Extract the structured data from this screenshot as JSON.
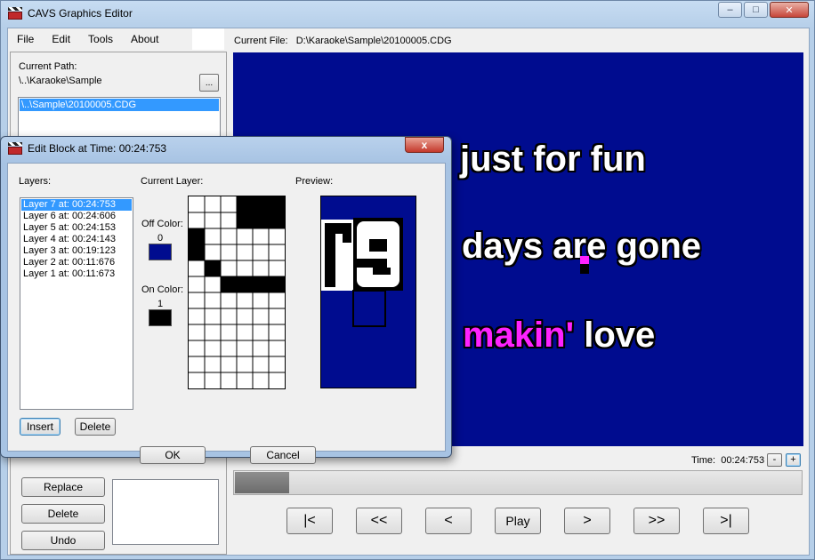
{
  "app": {
    "title": "CAVS Graphics Editor",
    "window_buttons": [
      "–",
      "□",
      "✕"
    ]
  },
  "menu": {
    "items": [
      "File",
      "Edit",
      "Tools",
      "About"
    ]
  },
  "left_panel": {
    "current_path_label": "Current Path:",
    "current_path_value": "\\..\\Karaoke\\Sample",
    "browse_label": "...",
    "files": [
      "\\..\\Sample\\20100005.CDG"
    ],
    "buttons": {
      "replace": "Replace",
      "delete": "Delete",
      "undo": "Undo"
    }
  },
  "file": {
    "label": "Current File:",
    "value": "D:\\Karaoke\\Sample\\20100005.CDG"
  },
  "stage": {
    "background": "#000c8f",
    "highlight_color": "#ff22ff",
    "lyrics": [
      {
        "pre": "",
        "hl": "",
        "post": "just for fun"
      },
      {
        "pre": "days are gone",
        "hl": "",
        "post": ""
      },
      {
        "pre": "",
        "hl": "makin'",
        "post": " love"
      }
    ]
  },
  "time": {
    "label": "Time:",
    "value": "00:24:753",
    "minus": "-",
    "plus": "+"
  },
  "timeline": {
    "progress": 0.095
  },
  "transport": {
    "buttons": [
      "|<",
      "<<",
      "<",
      "Play",
      ">",
      ">>",
      ">|"
    ]
  },
  "dialog": {
    "title": "Edit Block at Time: 00:24:753",
    "close_label": "x",
    "layers_label": "Layers:",
    "current_layer_label": "Current Layer:",
    "preview_label": "Preview:",
    "layers": [
      "Layer 7 at: 00:24:753",
      "Layer 6 at: 00:24:606",
      "Layer 5 at: 00:24:153",
      "Layer 4 at: 00:24:143",
      "Layer 3 at: 00:19:123",
      "Layer 2 at: 00:11:676",
      "Layer 1 at: 00:11:673"
    ],
    "selected_layer": 0,
    "off_color_label": "Off Color:",
    "off_color_index": "0",
    "off_color": "#000c8f",
    "on_color_label": "On Color:",
    "on_color_index": "1",
    "on_color": "#000000",
    "insert_label": "Insert",
    "delete_label": "Delete",
    "ok_label": "OK",
    "cancel_label": "Cancel"
  }
}
